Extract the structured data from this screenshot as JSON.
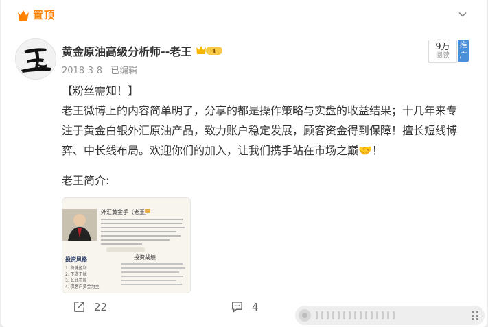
{
  "pinned": {
    "label": "置顶"
  },
  "post": {
    "author": "黄金原油高级分析师--老王",
    "vip_level": "1",
    "date": "2018-3-8",
    "edited": "已编辑",
    "reads": {
      "count": "9万",
      "label": "阅读"
    },
    "promote": "推广",
    "paragraphs": [
      "【粉丝需知！】",
      "老王微博上的内容简单明了，分享的都是操作策略与实盘的收益结果；十几年来专注于黄金白银外汇原油产品，致力账户稳定发展，顾客资金得到保障！擅长短线博弈、中长线布局。欢迎你们的加入，让我们携手站在市场之巅🤝！"
    ],
    "intro_label": "老王简介:",
    "thumbnail": {
      "heading": "外汇黄金手（老王）",
      "section_left": "投资风格",
      "section_right": "投资战绩",
      "items_left": [
        "1. 稳健盈利",
        "2. 不做干扰",
        "3. 长线布局",
        "4. 仅客户资金为主"
      ]
    },
    "actions": {
      "repost": "22",
      "comment": "4"
    }
  },
  "colors": {
    "accent": "#ff8200",
    "promo": "#4a8fd9",
    "text": "#333333",
    "muted": "#939393"
  }
}
